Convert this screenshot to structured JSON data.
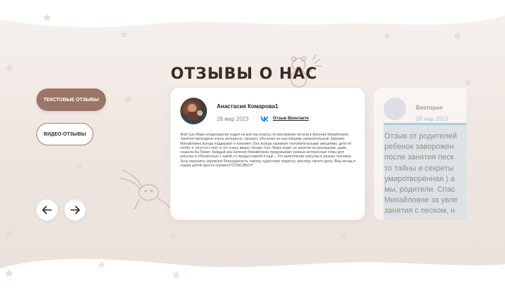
{
  "section": {
    "title": "ОТЗЫВЫ О НАС"
  },
  "tabs": {
    "text_reviews": "ТЕКСТОВЫЕ ОТЗЫВЫ",
    "video_reviews": "ВИДЕО-ОТЗЫВЫ"
  },
  "nav": {
    "prev_icon": "arrow-left-icon",
    "next_icon": "arrow-right-icon"
  },
  "reviews": [
    {
      "author": "Анастасия Комарова1",
      "date": "28 мар 2023",
      "vk_link": "Отзыв Вконтакте",
      "text": "Мой сын Марк неоднократно ходил на мастер-классы по рисованию песком к Евгении Михайловне. Занятия проходили очень интересно, процесс обучения по-настоящему увлекательный. Евгения Михайловна всегда поддержит и поможет. Она всегда заряжает положительными эмоциями, дети её любят и тянутся к ней, и это очень видно. Кроме того, Марк ходит на занятия по рисованию, даже, сказала бы бежит. Каждый раз Евгения Михайловна придумывает разные интересные темы для рисунка и обязательно с какой-то предысторией и ещё -, это выполнение рисунка в разных техниках. Хочу выразить огромную благодарность такому чудесному педагогу, мастеру своего дела. Ваш вклад в наших детей просто огромен!!!СПАСИБО!!!"
    },
    {
      "author": "Виктория",
      "date": "28 мар 2023",
      "screenshot_text": "Отзыв от родителей\nребенок заворожен\nпосле занятия песк\nто тайны и секреты\nумиротворённая ) а\nмы, родители. Спас\nМихайловне за увле\nзанятия с песком, н\nредкие, незамыслен"
    }
  ],
  "colors": {
    "accent": "#9b7565",
    "title": "#3b2b22",
    "background": "#efe6e1",
    "vk_blue": "#2787f5"
  }
}
